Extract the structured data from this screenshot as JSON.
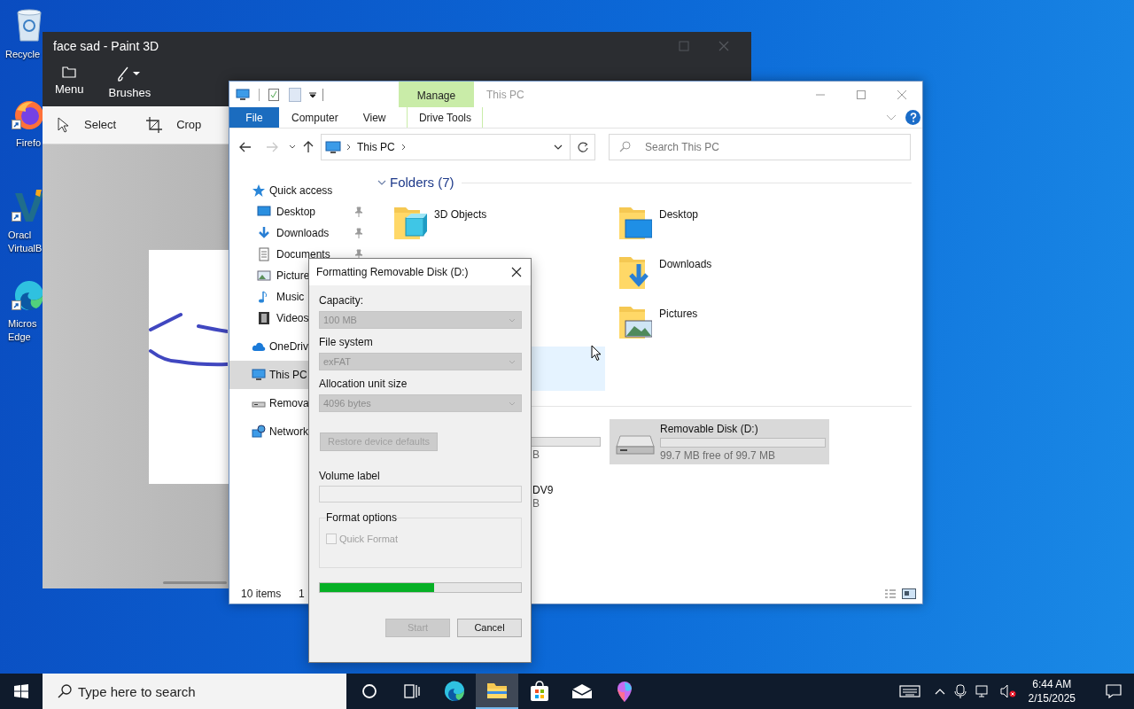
{
  "desktop_icons": [
    {
      "kind": "recycle-bin",
      "label": [
        "Recycle"
      ]
    },
    {
      "kind": "firefox",
      "label": [
        "Firefo"
      ]
    },
    {
      "kind": "virtualbox",
      "label": [
        "Oracl",
        "VirtualB"
      ]
    },
    {
      "kind": "edge",
      "label": [
        "Micros",
        "Edge"
      ]
    }
  ],
  "paint": {
    "title": "face sad - Paint 3D",
    "tools": [
      {
        "kind": "menu",
        "label": "Menu"
      },
      {
        "kind": "brushes",
        "label": "Brushes"
      }
    ],
    "toolbar": [
      {
        "kind": "select",
        "label": "Select"
      },
      {
        "kind": "crop",
        "label": "Crop"
      }
    ]
  },
  "explorer": {
    "title": "This PC",
    "context_tab": "Manage",
    "ribbon_tabs": [
      {
        "kind": "file",
        "label": "File"
      },
      {
        "kind": "tab",
        "label": "Computer"
      },
      {
        "kind": "tab",
        "label": "View"
      },
      {
        "kind": "context",
        "label": "Drive Tools"
      }
    ],
    "address": "This PC",
    "search_placeholder": "Search This PC",
    "nav": [
      {
        "kind": "star",
        "label": "Quick access",
        "selected": false,
        "children": [
          {
            "kind": "desktop",
            "label": "Desktop",
            "pinned": true
          },
          {
            "kind": "downloads",
            "label": "Downloads",
            "pinned": true
          },
          {
            "kind": "documents",
            "label": "Documents",
            "pinned": true
          },
          {
            "kind": "pictures",
            "label": "Picture"
          },
          {
            "kind": "music",
            "label": "Music"
          },
          {
            "kind": "videos",
            "label": "Videos"
          }
        ]
      },
      {
        "kind": "cloud",
        "label": "OneDriv",
        "selected": false
      },
      {
        "kind": "pc",
        "label": "This PC",
        "selected": true
      },
      {
        "kind": "drive",
        "label": "Remova",
        "selected": false
      },
      {
        "kind": "network",
        "label": "Network",
        "selected": false
      }
    ],
    "folders": {
      "header": "Folders (7)",
      "expanded": true,
      "left": [
        {
          "kind": "cube",
          "label": "3D Objects"
        }
      ],
      "right": [
        {
          "kind": "desktop",
          "label": "Desktop"
        },
        {
          "kind": "downloads",
          "label": "Downloads"
        },
        {
          "kind": "pictures",
          "label": "Pictures"
        }
      ]
    },
    "c_drive": {
      "size_fragment": "B"
    },
    "dvd_drive": {
      "name_fragment": "DV9",
      "size_fragment": "B"
    },
    "removable": {
      "name": "Removable Disk (D:)",
      "free": "99.7 MB free of 99.7 MB",
      "level": 0,
      "selected": true
    },
    "status": {
      "items": "10 items",
      "selection": "1"
    }
  },
  "dialog": {
    "title": "Formatting Removable Disk (D:)",
    "fields": [
      {
        "label": "Capacity:",
        "value": "100 MB",
        "disabled": true
      },
      {
        "label": "File system",
        "value": "exFAT",
        "disabled": true
      },
      {
        "label": "Allocation unit size",
        "value": "4096 bytes",
        "disabled": true
      }
    ],
    "restore_button": {
      "label": "Restore device defaults",
      "disabled": true
    },
    "volume_label": {
      "label": "Volume label"
    },
    "format_options": {
      "legend": "Format options",
      "quick_format": {
        "label": "Quick Format",
        "checked": false,
        "disabled": true
      }
    },
    "progress": {
      "level": 0.57
    },
    "buttons": [
      {
        "label": "Start",
        "disabled": true
      },
      {
        "label": "Cancel",
        "disabled": false
      }
    ]
  },
  "taskbar": {
    "search_placeholder": "Type here to search",
    "apps": [
      {
        "kind": "cortana",
        "active": false
      },
      {
        "kind": "task-view",
        "active": false
      },
      {
        "kind": "edge",
        "active": false
      },
      {
        "kind": "explorer",
        "active": true
      },
      {
        "kind": "store",
        "active": false
      },
      {
        "kind": "mail",
        "active": false
      },
      {
        "kind": "paint3d",
        "active": false
      }
    ],
    "time": "6:44 AM",
    "date": "2/15/2025"
  }
}
